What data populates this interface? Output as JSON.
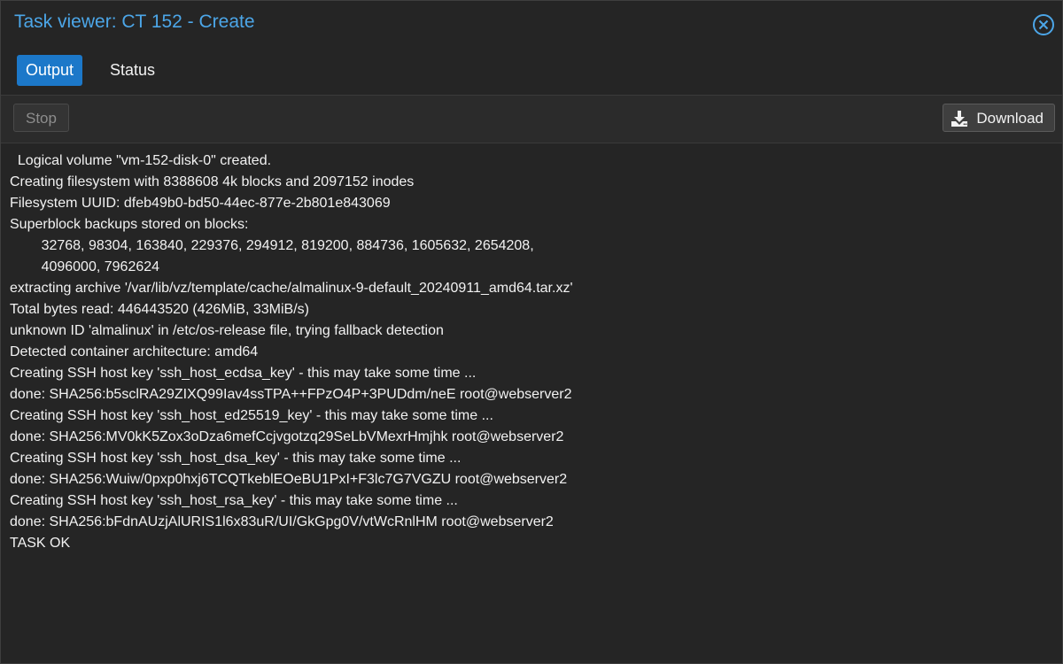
{
  "window": {
    "title": "Task viewer: CT 152 - Create"
  },
  "tabs": [
    {
      "label": "Output",
      "active": true
    },
    {
      "label": "Status",
      "active": false
    }
  ],
  "toolbar": {
    "stop_label": "Stop",
    "download_label": "Download"
  },
  "icons": {
    "close": "close-circle-icon",
    "download": "download-icon"
  },
  "colors": {
    "title": "#4ca6e8",
    "active_tab": "#1c78c9",
    "background": "#252525"
  },
  "log": [
    "  Logical volume \"vm-152-disk-0\" created.",
    "Creating filesystem with 8388608 4k blocks and 2097152 inodes",
    "Filesystem UUID: dfeb49b0-bd50-44ec-877e-2b801e843069",
    "Superblock backups stored on blocks:",
    "        32768, 98304, 163840, 229376, 294912, 819200, 884736, 1605632, 2654208,",
    "        4096000, 7962624",
    "extracting archive '/var/lib/vz/template/cache/almalinux-9-default_20240911_amd64.tar.xz'",
    "Total bytes read: 446443520 (426MiB, 33MiB/s)",
    "unknown ID 'almalinux' in /etc/os-release file, trying fallback detection",
    "Detected container architecture: amd64",
    "Creating SSH host key 'ssh_host_ecdsa_key' - this may take some time ...",
    "done: SHA256:b5sclRA29ZIXQ99Iav4ssTPA++FPzO4P+3PUDdm/neE root@webserver2",
    "Creating SSH host key 'ssh_host_ed25519_key' - this may take some time ...",
    "done: SHA256:MV0kK5Zox3oDza6mefCcjvgotzq29SeLbVMexrHmjhk root@webserver2",
    "Creating SSH host key 'ssh_host_dsa_key' - this may take some time ...",
    "done: SHA256:Wuiw/0pxp0hxj6TCQTkeblEOeBU1PxI+F3lc7G7VGZU root@webserver2",
    "Creating SSH host key 'ssh_host_rsa_key' - this may take some time ...",
    "done: SHA256:bFdnAUzjAlURIS1l6x83uR/UI/GkGpg0V/vtWcRnlHM root@webserver2",
    "TASK OK"
  ]
}
